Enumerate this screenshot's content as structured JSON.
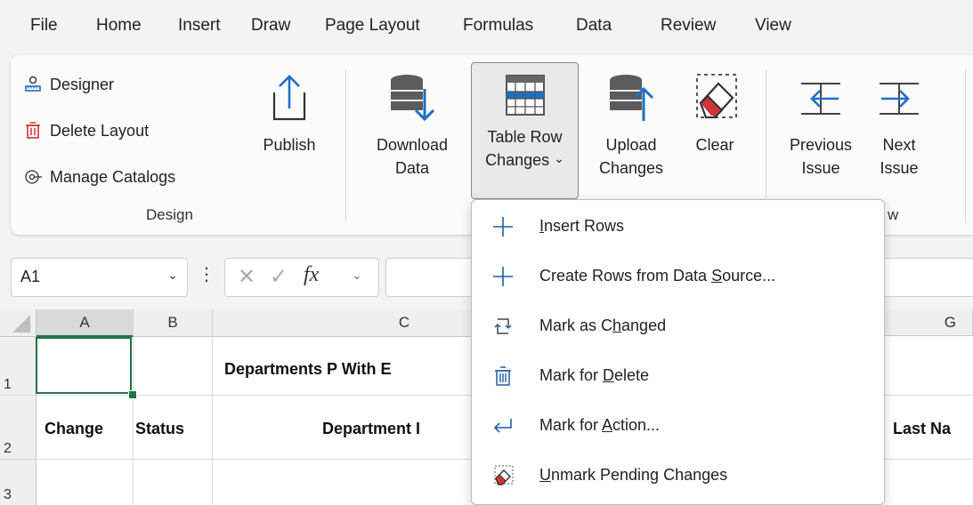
{
  "menubar": {
    "items": [
      "File",
      "Home",
      "Insert",
      "Draw",
      "Page Layout",
      "Formulas",
      "Data",
      "Review",
      "View"
    ]
  },
  "ribbon": {
    "design_group": {
      "designer": "Designer",
      "delete_layout": "Delete Layout",
      "manage_catalogs": "Manage Catalogs",
      "label": "Design"
    },
    "publish": "Publish",
    "download": {
      "line1": "Download",
      "line2": "Data"
    },
    "table_row": {
      "line1": "Table Row",
      "line2": "Changes",
      "chevron": "⌄"
    },
    "upload": {
      "line1": "Upload",
      "line2": "Changes"
    },
    "clear": "Clear",
    "previous": {
      "line1": "Previous",
      "line2": "Issue"
    },
    "next": {
      "line1": "Next",
      "line2": "Issue"
    },
    "partial_group_label": "w"
  },
  "formula_bar": {
    "namebox": "A1",
    "fx": "fx"
  },
  "grid": {
    "columns": [
      "A",
      "B",
      "C",
      "G"
    ],
    "rows": [
      "1",
      "2",
      "3"
    ],
    "cells": {
      "c1": "Departments P With E",
      "a2": "Change",
      "b2": "Status",
      "c2": "Department I",
      "g2": "Last Na"
    }
  },
  "dropdown": {
    "items": [
      {
        "pre": "",
        "u": "I",
        "post": "nsert Rows"
      },
      {
        "pre": "Create Rows from Data ",
        "u": "S",
        "post": "ource..."
      },
      {
        "pre": "Mark as C",
        "u": "h",
        "post": "anged"
      },
      {
        "pre": "Mark for ",
        "u": "D",
        "post": "elete"
      },
      {
        "pre": "Mark for ",
        "u": "A",
        "post": "ction..."
      },
      {
        "pre": "",
        "u": "U",
        "post": "nmark Pending Changes"
      }
    ]
  },
  "colors": {
    "accent_blue": "#1f6fc5",
    "delete_red": "#d13438",
    "selection_green": "#217346"
  }
}
